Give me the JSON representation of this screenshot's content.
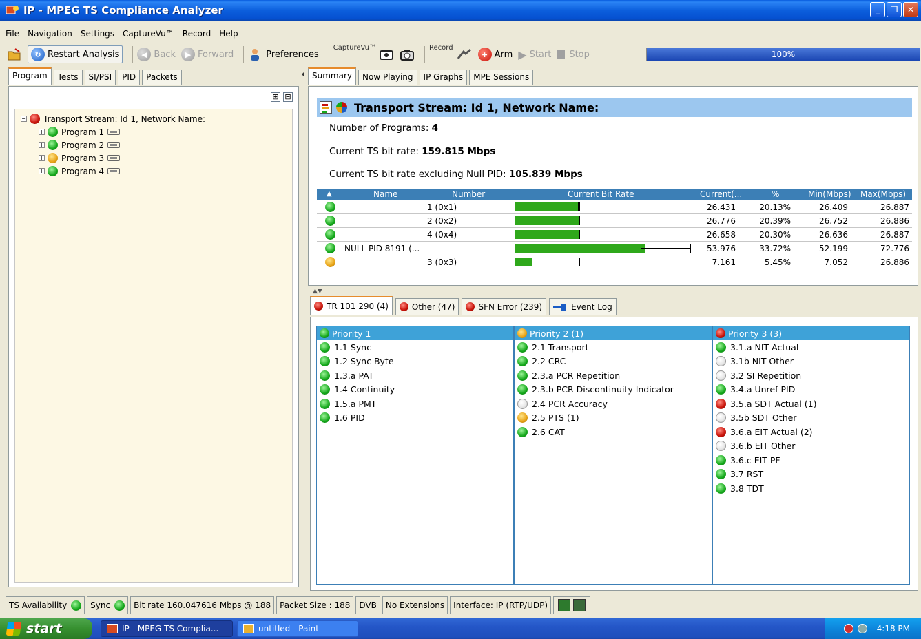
{
  "window": {
    "title": "IP - MPEG TS Compliance Analyzer",
    "min": "_",
    "max": "❐",
    "close": "✕"
  },
  "menu": [
    "File",
    "Navigation",
    "Settings",
    "CaptureVu™",
    "Record",
    "Help"
  ],
  "toolbar": {
    "restart": "Restart Analysis",
    "back": "Back",
    "forward": "Forward",
    "preferences": "Preferences",
    "capturevu_label": "CaptureVu™",
    "record_label": "Record",
    "arm": "Arm",
    "start": "Start",
    "stop": "Stop",
    "progress_text": "100%",
    "progress_fraction": 1.0
  },
  "left_tabs": [
    "Program",
    "Tests",
    "SI/PSI",
    "PID",
    "Packets"
  ],
  "tree": {
    "expand_all": "⊞",
    "collapse_all": "⊟",
    "root": {
      "label": "Transport Stream: Id 1, Network Name:",
      "status": "red"
    },
    "programs": [
      {
        "label": "Program 1",
        "status": "green"
      },
      {
        "label": "Program 2",
        "status": "green"
      },
      {
        "label": "Program 3",
        "status": "orange"
      },
      {
        "label": "Program 4",
        "status": "green"
      }
    ]
  },
  "right_tabs": [
    "Summary",
    "Now Playing",
    "IP Graphs",
    "MPE Sessions"
  ],
  "summary": {
    "header": "Transport Stream: Id 1, Network Name:",
    "num_programs_label": "Number of Programs: ",
    "num_programs": "4",
    "bitrate_label": "Current TS bit rate: ",
    "bitrate": "159.815 Mbps",
    "bitrate_nonull_label": "Current TS bit rate excluding Null PID: ",
    "bitrate_nonull": "105.839 Mbps"
  },
  "program_table": {
    "columns": [
      "▲",
      "Name",
      "Number",
      "Current Bit Rate",
      "Current(...",
      "%",
      "Min(Mbps)",
      "Max(Mbps)"
    ],
    "rows": [
      {
        "status": "green",
        "name": "",
        "number": "1 (0x1)",
        "current": "26.431",
        "pct": "20.13%",
        "min": "26.409",
        "max": "26.887",
        "cur_v": 26.431,
        "min_v": 26.409,
        "max_v": 26.887
      },
      {
        "status": "green",
        "name": "",
        "number": "2 (0x2)",
        "current": "26.776",
        "pct": "20.39%",
        "min": "26.752",
        "max": "26.886",
        "cur_v": 26.776,
        "min_v": 26.752,
        "max_v": 26.886
      },
      {
        "status": "green",
        "name": "",
        "number": "4 (0x4)",
        "current": "26.658",
        "pct": "20.30%",
        "min": "26.636",
        "max": "26.887",
        "cur_v": 26.658,
        "min_v": 26.636,
        "max_v": 26.887
      },
      {
        "status": "green",
        "name": "NULL PID 8191 (...",
        "number": "",
        "current": "53.976",
        "pct": "33.72%",
        "min": "52.199",
        "max": "72.776",
        "cur_v": 53.976,
        "min_v": 52.199,
        "max_v": 72.776
      },
      {
        "status": "orange",
        "name": "",
        "number": "3 (0x3)",
        "current": "7.161",
        "pct": "5.45%",
        "min": "7.052",
        "max": "26.886",
        "cur_v": 7.161,
        "min_v": 7.052,
        "max_v": 26.886
      }
    ]
  },
  "bottom_tabs": [
    {
      "label": "TR 101 290 (4)",
      "status": "red"
    },
    {
      "label": "Other (47)",
      "status": "red"
    },
    {
      "label": "SFN Error (239)",
      "status": "red"
    },
    {
      "label": "Event Log",
      "status": "pin"
    }
  ],
  "priorities": [
    {
      "header": "Priority 1",
      "status": "green",
      "items": [
        {
          "label": "1.1 Sync",
          "status": "green"
        },
        {
          "label": "1.2 Sync Byte",
          "status": "green"
        },
        {
          "label": "1.3.a PAT",
          "status": "green"
        },
        {
          "label": "1.4 Continuity",
          "status": "green"
        },
        {
          "label": "1.5.a PMT",
          "status": "green"
        },
        {
          "label": "1.6 PID",
          "status": "green"
        }
      ]
    },
    {
      "header": "Priority 2 (1)",
      "status": "orange",
      "items": [
        {
          "label": "2.1 Transport",
          "status": "green"
        },
        {
          "label": "2.2 CRC",
          "status": "green"
        },
        {
          "label": "2.3.a PCR Repetition",
          "status": "green"
        },
        {
          "label": "2.3.b PCR Discontinuity Indicator",
          "status": "green"
        },
        {
          "label": "2.4 PCR Accuracy",
          "status": "white"
        },
        {
          "label": "2.5 PTS (1)",
          "status": "orange"
        },
        {
          "label": "2.6 CAT",
          "status": "green"
        }
      ]
    },
    {
      "header": "Priority 3 (3)",
      "status": "red",
      "items": [
        {
          "label": "3.1.a NIT Actual",
          "status": "green"
        },
        {
          "label": "3.1b NIT Other",
          "status": "white"
        },
        {
          "label": "3.2 SI Repetition",
          "status": "white"
        },
        {
          "label": "3.4.a Unref PID",
          "status": "green"
        },
        {
          "label": "3.5.a SDT Actual (1)",
          "status": "red"
        },
        {
          "label": "3.5b SDT Other",
          "status": "white"
        },
        {
          "label": "3.6.a EIT Actual (2)",
          "status": "red"
        },
        {
          "label": "3.6.b EIT Other",
          "status": "white"
        },
        {
          "label": "3.6.c EIT PF",
          "status": "green"
        },
        {
          "label": "3.7 RST",
          "status": "green"
        },
        {
          "label": "3.8 TDT",
          "status": "green"
        }
      ]
    }
  ],
  "statusbar": {
    "ts_availability": "TS Availability",
    "sync": "Sync",
    "bitrate": "Bit rate  160.047616 Mbps @ 188",
    "packet_size": "Packet Size : 188",
    "dvb": "DVB",
    "extensions": "No Extensions",
    "interface": "Interface: IP (RTP/UDP)"
  },
  "taskbar": {
    "start": "start",
    "task1": "IP - MPEG TS Complia...",
    "task2": "untitled - Paint",
    "clock": "4:18 PM"
  }
}
